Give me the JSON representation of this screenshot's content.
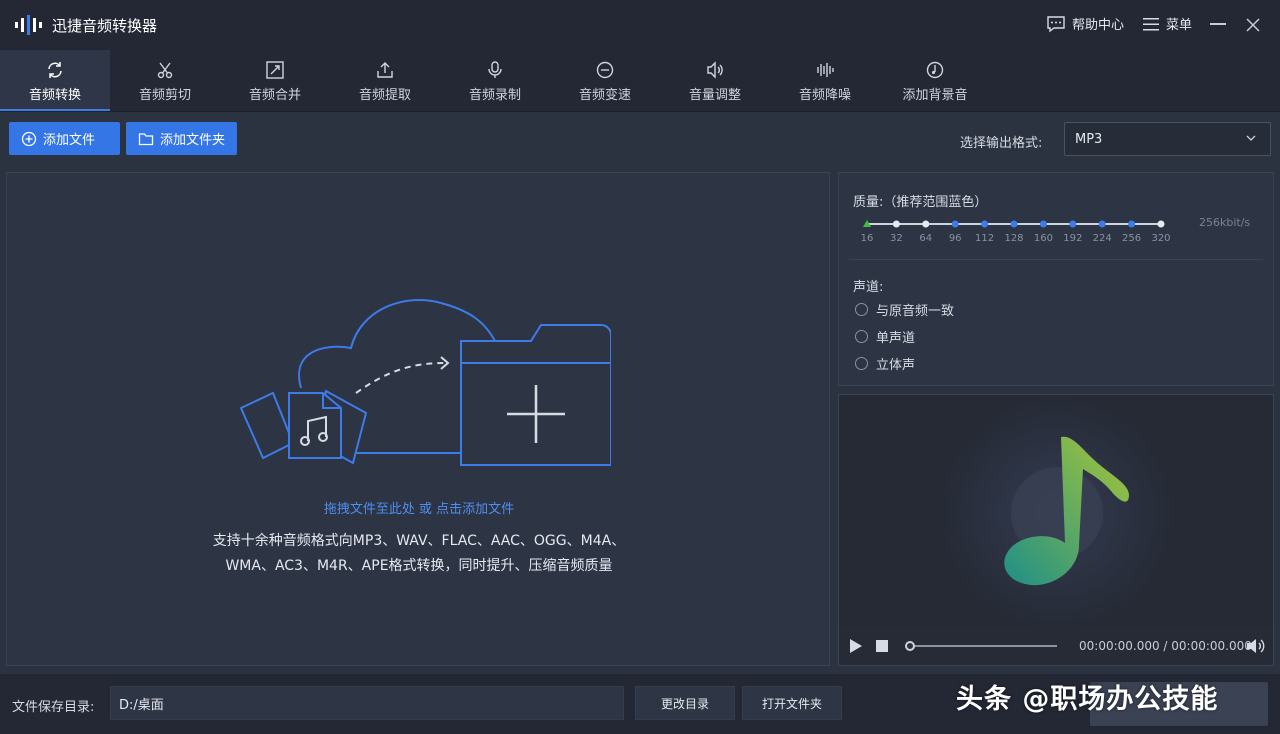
{
  "app": {
    "title": "迅捷音频转换器"
  },
  "header": {
    "help_label": "帮助中心",
    "menu_label": "菜单"
  },
  "tabs": [
    {
      "label": "音频转换",
      "icon": "refresh-icon",
      "active": true
    },
    {
      "label": "音频剪切",
      "icon": "scissors-icon"
    },
    {
      "label": "音频合并",
      "icon": "merge-icon"
    },
    {
      "label": "音频提取",
      "icon": "extract-icon"
    },
    {
      "label": "音频录制",
      "icon": "microphone-icon"
    },
    {
      "label": "音频变速",
      "icon": "speed-icon"
    },
    {
      "label": "音量调整",
      "icon": "volume-icon"
    },
    {
      "label": "音频降噪",
      "icon": "waveform-icon"
    },
    {
      "label": "添加背景音",
      "icon": "music-note-icon"
    }
  ],
  "toolbar": {
    "add_file_label": "添加文件",
    "add_folder_label": "添加文件夹",
    "format_label": "选择输出格式:",
    "format_value": "MP3"
  },
  "drop": {
    "hint": "拖拽文件至此处 或 点击添加文件",
    "support_line1": "支持十余种音频格式向MP3、WAV、FLAC、AAC、OGG、M4A、",
    "support_line2": "WMA、AC3、M4R、APE格式转换，同时提升、压缩音频质量"
  },
  "quality": {
    "title": "质量:（推荐范围蓝色）",
    "value": "256kbit/s",
    "ticks": [
      "16",
      "32",
      "64",
      "96",
      "112",
      "128",
      "160",
      "192",
      "224",
      "256",
      "320"
    ],
    "selected": "16",
    "recommended": [
      "96",
      "112",
      "128",
      "160",
      "192",
      "224",
      "256"
    ]
  },
  "channel": {
    "title": "声道:",
    "options": [
      "与原音频一致",
      "单声道",
      "立体声"
    ]
  },
  "player": {
    "time": "00:00:00.000 / 00:00:00.000"
  },
  "footer": {
    "save_label": "文件保存目录:",
    "save_path": "D:/桌面",
    "change_dir_label": "更改目录",
    "open_folder_label": "打开文件夹"
  },
  "watermark": "头条 @职场办公技能",
  "colors": {
    "accent": "#3476e5",
    "background": "#2b3240",
    "titlebar": "#232834"
  }
}
